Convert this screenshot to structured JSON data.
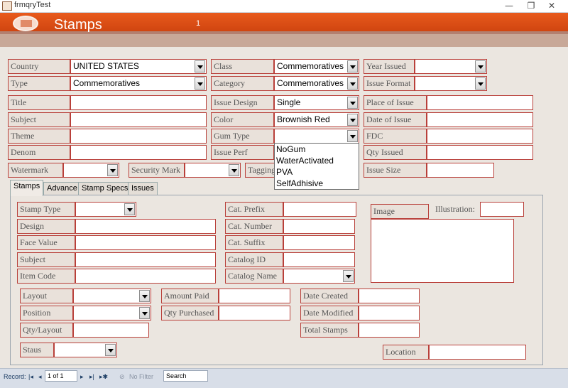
{
  "window": {
    "title": "frmqryTest",
    "min": "—",
    "max": "❐",
    "close": "✕"
  },
  "header": {
    "form_title": "Stamps",
    "page_number": "1"
  },
  "top_fields": {
    "country": {
      "label": "Country",
      "value": "UNITED STATES"
    },
    "type": {
      "label": "Type",
      "value": "Commemoratives"
    },
    "title": {
      "label": "Title",
      "value": ""
    },
    "subject": {
      "label": "Subject",
      "value": ""
    },
    "theme": {
      "label": "Theme",
      "value": ""
    },
    "denom": {
      "label": "Denom",
      "value": ""
    },
    "watermark": {
      "label": "Watermark",
      "value": ""
    },
    "security_mark": {
      "label": "Security Mark",
      "value": ""
    },
    "tagging": {
      "label": "Tagging"
    },
    "class": {
      "label": "Class",
      "value": "Commemoratives"
    },
    "category": {
      "label": "Category",
      "value": "Commemoratives"
    },
    "issue_design": {
      "label": "Issue Design",
      "value": "Single"
    },
    "color": {
      "label": "Color",
      "value": "Brownish Red"
    },
    "gum_type": {
      "label": "Gum Type",
      "value": ""
    },
    "issue_perf": {
      "label": "Issue Perf"
    },
    "year_issued": {
      "label": "Year Issued",
      "value": ""
    },
    "issue_format": {
      "label": "Issue Format",
      "value": ""
    },
    "place_of_issue": {
      "label": "Place of Issue",
      "value": ""
    },
    "date_of_issue": {
      "label": "Date of Issue",
      "value": ""
    },
    "fdc": {
      "label": "FDC",
      "value": ""
    },
    "qty_issued": {
      "label": "Qty Issued",
      "value": ""
    },
    "issue_size": {
      "label": "Issue Size",
      "value": ""
    }
  },
  "gum_dropdown": {
    "options": [
      "NoGum",
      "WaterActivated",
      "PVA",
      "SelfAdhisive"
    ]
  },
  "tabs": [
    "Stamps",
    "Advance",
    "Stamp Specs",
    "Issues"
  ],
  "stamps_tab": {
    "stamp_type": "Stamp Type",
    "design": "Design",
    "face_value": "Face Value",
    "subject": "Subject",
    "item_code": "Item Code",
    "cat_prefix": "Cat. Prefix",
    "cat_number": "Cat. Number",
    "cat_suffix": "Cat. Suffix",
    "catalog_id": "Catalog ID",
    "catalog_name": "Catalog Name",
    "image": "Image",
    "illustration": "Illustration:",
    "layout": "Layout",
    "position": "Position",
    "qty_layout": "Qty/Layout",
    "amount_paid": "Amount Paid",
    "qty_purchased": "Qty Purchased",
    "date_created": "Date Created",
    "date_modified": "Date Modified",
    "total_stamps": "Total Stamps",
    "status": "Staus",
    "location": "Location"
  },
  "navigation": {
    "record_label": "Record:",
    "current": "1 of 1",
    "filter": "No Filter",
    "search": "Search"
  }
}
